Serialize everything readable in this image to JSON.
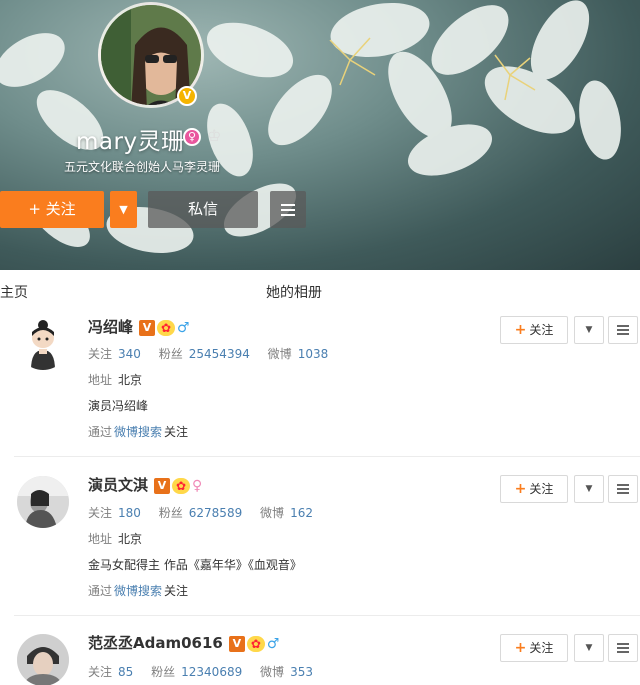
{
  "profile": {
    "name": "mary灵珊",
    "bio": "五元文化联合创始人马李灵珊",
    "verified_icon": "verified-badge-icon",
    "gender_icon": "female-icon",
    "crown_icon": "crown-icon",
    "follow_label": "+ 关注",
    "message_label": "私信"
  },
  "tabs": {
    "home": "主页",
    "album": "她的相册"
  },
  "users": [
    {
      "name": "冯绍峰",
      "badges": {
        "v": "V",
        "vip": "✿",
        "gender": "♂"
      },
      "following_label": "关注",
      "following": "340",
      "fans_label": "粉丝",
      "fans": "25454394",
      "posts_label": "微博",
      "posts": "1038",
      "address_label": "地址",
      "address": "北京",
      "desc": "演员冯绍峰",
      "via_prefix": "通过",
      "via_link": "微博搜索",
      "via_suffix": "关注",
      "follow_label": "关注"
    },
    {
      "name": "演员文淇",
      "badges": {
        "v": "V",
        "vip": "✿",
        "gender": "♀"
      },
      "following_label": "关注",
      "following": "180",
      "fans_label": "粉丝",
      "fans": "6278589",
      "posts_label": "微博",
      "posts": "162",
      "address_label": "地址",
      "address": "北京",
      "desc": "金马女配得主 作品《嘉年华》《血观音》",
      "via_prefix": "通过",
      "via_link": "微博搜索",
      "via_suffix": "关注",
      "follow_label": "关注"
    },
    {
      "name": "范丞丞Adam0616",
      "badges": {
        "v": "V",
        "vip": "✿",
        "gender": "♂"
      },
      "following_label": "关注",
      "following": "85",
      "fans_label": "粉丝",
      "fans": "12340689",
      "posts_label": "微博",
      "posts": "353",
      "follow_label": "关注"
    }
  ],
  "colors": {
    "accent_orange": "#fa7d1e",
    "link_blue": "#4a7fb0",
    "verified_orange": "#e8711a"
  }
}
